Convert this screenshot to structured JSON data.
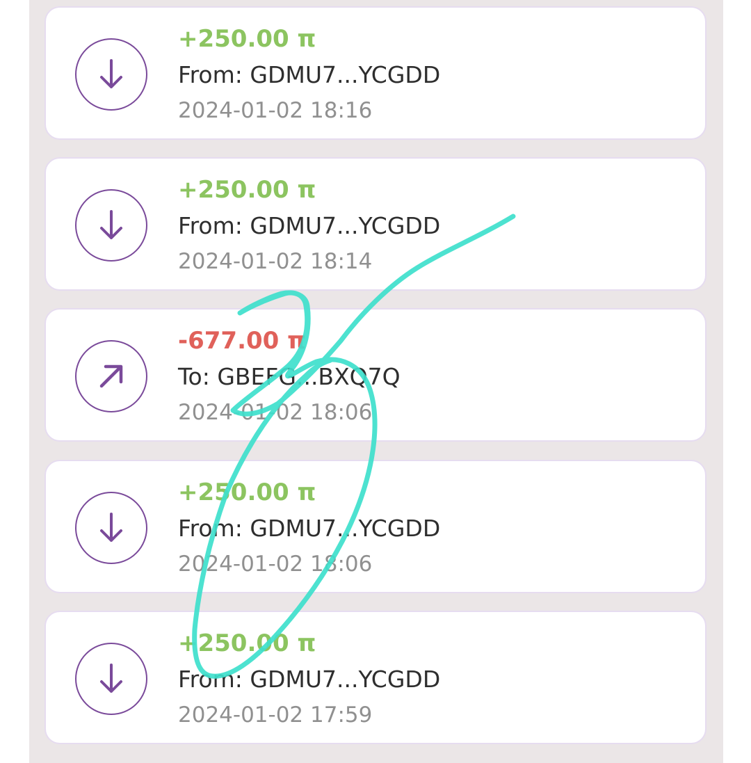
{
  "colors": {
    "incoming": "#8cc460",
    "outgoing": "#e0615a",
    "icon_accent": "#7a4a9a",
    "scribble": "#3ee0cc"
  },
  "transactions": [
    {
      "direction": "in",
      "icon": "arrow-down-icon",
      "amount": "+250.00 π",
      "party": "From: GDMU7...YCGDD",
      "date": "2024-01-02 18:16"
    },
    {
      "direction": "in",
      "icon": "arrow-down-icon",
      "amount": "+250.00 π",
      "party": "From: GDMU7...YCGDD",
      "date": "2024-01-02 18:14"
    },
    {
      "direction": "out",
      "icon": "arrow-up-right-icon",
      "amount": "-677.00 π",
      "party": "To: GBEFG...BXQ7Q",
      "date": "2024-01-02 18:06"
    },
    {
      "direction": "in",
      "icon": "arrow-down-icon",
      "amount": "+250.00 π",
      "party": "From: GDMU7...YCGDD",
      "date": "2024-01-02 18:06"
    },
    {
      "direction": "in",
      "icon": "arrow-down-icon",
      "amount": "+250.00 π",
      "party": "From: GDMU7...YCGDD",
      "date": "2024-01-02 17:59"
    }
  ]
}
